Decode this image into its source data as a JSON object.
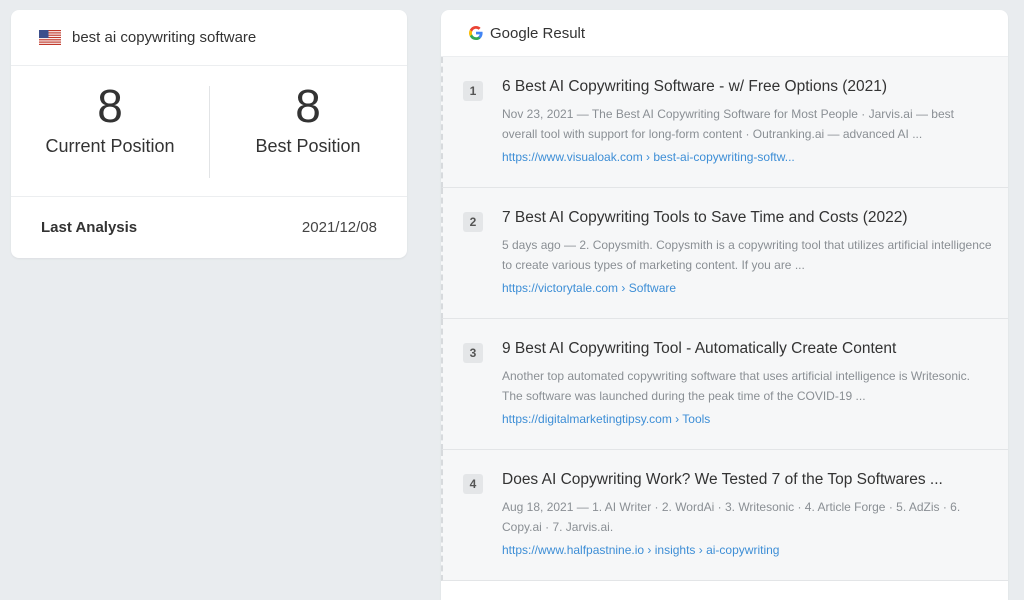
{
  "keyword_card": {
    "flag_icon": "us-flag-icon",
    "keyword": "best ai copywriting software",
    "current_position": "8",
    "current_position_label": "Current Position",
    "best_position": "8",
    "best_position_label": "Best Position",
    "last_analysis_label": "Last Analysis",
    "last_analysis_date": "2021/12/08"
  },
  "google_result": {
    "icon": "google-icon",
    "title": "Google Result",
    "results": [
      {
        "rank": "1",
        "title": "6 Best AI Copywriting Software - w/ Free Options (2021)",
        "snippet": "Nov 23, 2021 — The Best AI Copywriting Software for Most People · Jarvis.ai — best overall tool with support for long-form content · Outranking.ai — advanced AI ...",
        "url": "https://www.visualoak.com › best-ai-copywriting-softw..."
      },
      {
        "rank": "2",
        "title": "7 Best AI Copywriting Tools to Save Time and Costs (2022)",
        "snippet": "5 days ago — 2. Copysmith. Copysmith is a copywriting tool that utilizes artificial intelligence to create various types of marketing content. If you are ...",
        "url": "https://victorytale.com › Software"
      },
      {
        "rank": "3",
        "title": "9 Best AI Copywriting Tool - Automatically Create Content",
        "snippet": "Another top automated copywriting software that uses artificial intelligence is Writesonic. The software was launched during the peak time of the COVID-19 ...",
        "url": "https://digitalmarketingtipsy.com › Tools"
      },
      {
        "rank": "4",
        "title": "Does AI Copywriting Work? We Tested 7 of the Top Softwares ...",
        "snippet": "Aug 18, 2021 — 1. AI Writer · 2. WordAi · 3. Writesonic · 4. Article Forge · 5. AdZis · 6. Copy.ai · 7. Jarvis.ai.",
        "url": "https://www.halfpastnine.io › insights › ai-copywriting"
      }
    ]
  }
}
